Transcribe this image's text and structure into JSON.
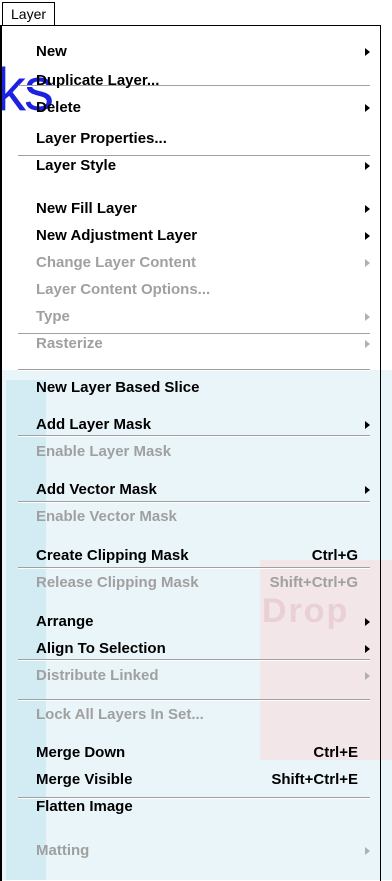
{
  "menu_title": "Layer",
  "watermark": {
    "overlay_text": "ks",
    "bg_text": "Drop"
  },
  "items": [
    {
      "label": "New",
      "shortcut": "",
      "submenu": true,
      "enabled": true
    },
    {
      "label": "Duplicate Layer...",
      "shortcut": "",
      "submenu": false,
      "enabled": true
    },
    {
      "label": "Delete",
      "shortcut": "",
      "submenu": true,
      "enabled": true
    },
    {
      "label": "Layer Properties...",
      "shortcut": "",
      "submenu": false,
      "enabled": true
    },
    {
      "label": "Layer Style",
      "shortcut": "",
      "submenu": true,
      "enabled": true
    },
    {
      "label": "New Fill Layer",
      "shortcut": "",
      "submenu": true,
      "enabled": true
    },
    {
      "label": "New Adjustment Layer",
      "shortcut": "",
      "submenu": true,
      "enabled": true
    },
    {
      "label": "Change Layer Content",
      "shortcut": "",
      "submenu": true,
      "enabled": false
    },
    {
      "label": "Layer Content Options...",
      "shortcut": "",
      "submenu": false,
      "enabled": false
    },
    {
      "label": "Type",
      "shortcut": "",
      "submenu": true,
      "enabled": false
    },
    {
      "label": "Rasterize",
      "shortcut": "",
      "submenu": true,
      "enabled": false
    },
    {
      "label": "New Layer Based Slice",
      "shortcut": "",
      "submenu": false,
      "enabled": true
    },
    {
      "label": "Add Layer Mask",
      "shortcut": "",
      "submenu": true,
      "enabled": true
    },
    {
      "label": "Enable Layer Mask",
      "shortcut": "",
      "submenu": false,
      "enabled": false
    },
    {
      "label": "Add Vector Mask",
      "shortcut": "",
      "submenu": true,
      "enabled": true
    },
    {
      "label": "Enable Vector Mask",
      "shortcut": "",
      "submenu": false,
      "enabled": false
    },
    {
      "label": "Create Clipping Mask",
      "shortcut": "Ctrl+G",
      "submenu": false,
      "enabled": true
    },
    {
      "label": "Release Clipping Mask",
      "shortcut": "Shift+Ctrl+G",
      "submenu": false,
      "enabled": false
    },
    {
      "label": "Arrange",
      "shortcut": "",
      "submenu": true,
      "enabled": true
    },
    {
      "label": "Align To Selection",
      "shortcut": "",
      "submenu": true,
      "enabled": true
    },
    {
      "label": "Distribute Linked",
      "shortcut": "",
      "submenu": true,
      "enabled": false
    },
    {
      "label": "Lock All Layers In Set...",
      "shortcut": "",
      "submenu": false,
      "enabled": false
    },
    {
      "label": "Merge Down",
      "shortcut": "Ctrl+E",
      "submenu": false,
      "enabled": true
    },
    {
      "label": "Merge Visible",
      "shortcut": "Shift+Ctrl+E",
      "submenu": false,
      "enabled": true
    },
    {
      "label": "Flatten Image",
      "shortcut": "",
      "submenu": false,
      "enabled": true
    },
    {
      "label": "Matting",
      "shortcut": "",
      "submenu": true,
      "enabled": false
    }
  ]
}
